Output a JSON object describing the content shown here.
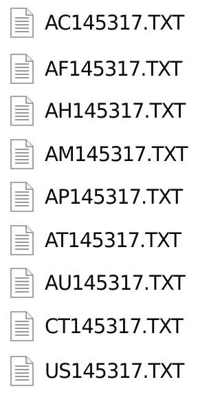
{
  "files": [
    {
      "name": "AC145317.TXT",
      "icon": "text-file-icon"
    },
    {
      "name": "AF145317.TXT",
      "icon": "text-file-icon"
    },
    {
      "name": "AH145317.TXT",
      "icon": "text-file-icon"
    },
    {
      "name": "AM145317.TXT",
      "icon": "text-file-icon"
    },
    {
      "name": "AP145317.TXT",
      "icon": "text-file-icon"
    },
    {
      "name": "AT145317.TXT",
      "icon": "text-file-icon"
    },
    {
      "name": "AU145317.TXT",
      "icon": "text-file-icon"
    },
    {
      "name": "CT145317.TXT",
      "icon": "text-file-icon"
    },
    {
      "name": "US145317.TXT",
      "icon": "text-file-icon"
    }
  ]
}
